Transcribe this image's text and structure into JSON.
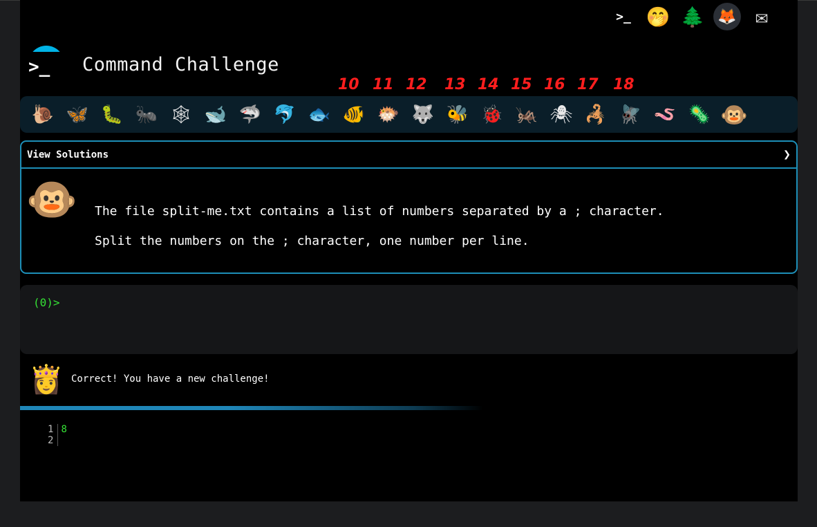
{
  "header": {
    "title": "Command Challenge",
    "logo_glyph": ">_",
    "top_icons": [
      {
        "name": "terminal-logo-icon",
        "glyph": ">_"
      },
      {
        "name": "shushing-face-icon",
        "glyph": "🤭"
      },
      {
        "name": "tree-icon",
        "glyph": "🌲"
      },
      {
        "name": "gitlab-icon",
        "glyph": "🦊"
      },
      {
        "name": "envelope-icon",
        "glyph": "✉"
      }
    ]
  },
  "annotations": [
    "10",
    "11",
    "12",
    "13",
    "14",
    "15",
    "16",
    "17",
    "18"
  ],
  "levels": [
    {
      "name": "snail",
      "glyph": "🐌"
    },
    {
      "name": "butterfly",
      "glyph": "🦋"
    },
    {
      "name": "caterpillar",
      "glyph": "🐛"
    },
    {
      "name": "ant",
      "glyph": "🐜"
    },
    {
      "name": "spider-web",
      "glyph": "🕸"
    },
    {
      "name": "whale",
      "glyph": "🐋"
    },
    {
      "name": "shark",
      "glyph": "🦈"
    },
    {
      "name": "dolphin",
      "glyph": "🐬"
    },
    {
      "name": "fish",
      "glyph": "🐟"
    },
    {
      "name": "tropical-fish",
      "glyph": "🐠"
    },
    {
      "name": "blowfish",
      "glyph": "🐡"
    },
    {
      "name": "wolf",
      "glyph": "🐺"
    },
    {
      "name": "bee",
      "glyph": "🐝"
    },
    {
      "name": "ladybug",
      "glyph": "🐞"
    },
    {
      "name": "cricket",
      "glyph": "🦗"
    },
    {
      "name": "spider",
      "glyph": "🕷"
    },
    {
      "name": "scorpion",
      "glyph": "🦂"
    },
    {
      "name": "fly",
      "glyph": "🪰"
    },
    {
      "name": "worm",
      "glyph": "🪱"
    },
    {
      "name": "microbe",
      "glyph": "🦠"
    },
    {
      "name": "monkey",
      "glyph": "🐵"
    }
  ],
  "solutions": {
    "header": "View Solutions",
    "chevron": "❯",
    "avatar": "🐵",
    "line1": "The file split-me.txt contains a list of numbers separated by a ; character.",
    "line2": "Split the numbers on the ; character, one number per line."
  },
  "terminal": {
    "prompt": "(0)>"
  },
  "feedback": {
    "avatar": "👸",
    "text": "Correct! You have a new challenge!"
  },
  "output": {
    "line_numbers": [
      "1",
      "2"
    ],
    "lines": [
      "8",
      ""
    ]
  },
  "colors": {
    "accent": "#1d8fb8",
    "prompt_green": "#35e135",
    "annotation_red": "#ff1e1e",
    "level_bar": "#0a1e29"
  }
}
